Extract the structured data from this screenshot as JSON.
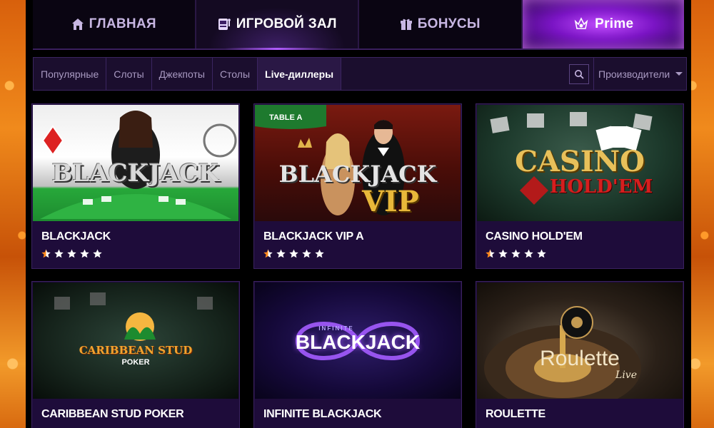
{
  "nav": {
    "items": [
      {
        "label": "ГЛАВНАЯ",
        "icon": "home-icon"
      },
      {
        "label": "ИГРОВОЙ ЗАЛ",
        "icon": "slot-machine-icon"
      },
      {
        "label": "БОНУСЫ",
        "icon": "gift-icon"
      },
      {
        "label": "Prime",
        "icon": "crown-logo-icon"
      }
    ]
  },
  "filters": {
    "tabs": [
      "Популярные",
      "Слоты",
      "Джекпоты",
      "Столы",
      "Live-диллеры"
    ],
    "active_tab": "Live-диллеры",
    "providers_label": "Производители"
  },
  "games": [
    {
      "title": "BLACKJACK",
      "logo": "BLACKJACK",
      "rating": 1
    },
    {
      "title": "BLACKJACK VIP A",
      "logo": "BLACKJACK",
      "logo_sub": "VIP",
      "table_tag": "TABLE A",
      "rating": 1
    },
    {
      "title": "CASINO HOLD'EM",
      "logo": "CASINO",
      "logo_sub": "HOLD'EM",
      "rating": 1
    },
    {
      "title": "CARIBBEAN STUD POKER",
      "logo": "CARIBBEAN STUD",
      "logo_sub": "POKER",
      "rating": 0
    },
    {
      "title": "INFINITE BLACKJACK",
      "logo_top": "INFINITE",
      "logo": "BLACKJACK",
      "rating": 0
    },
    {
      "title": "ROULETTE",
      "logo": "Roulette",
      "logo_sub": "Live",
      "rating": 0
    }
  ],
  "colors": {
    "accent": "#b15cff",
    "star_filled": "#ff8a1e",
    "star_empty": "#ffffff",
    "card_bg": "#1e0c3a"
  }
}
